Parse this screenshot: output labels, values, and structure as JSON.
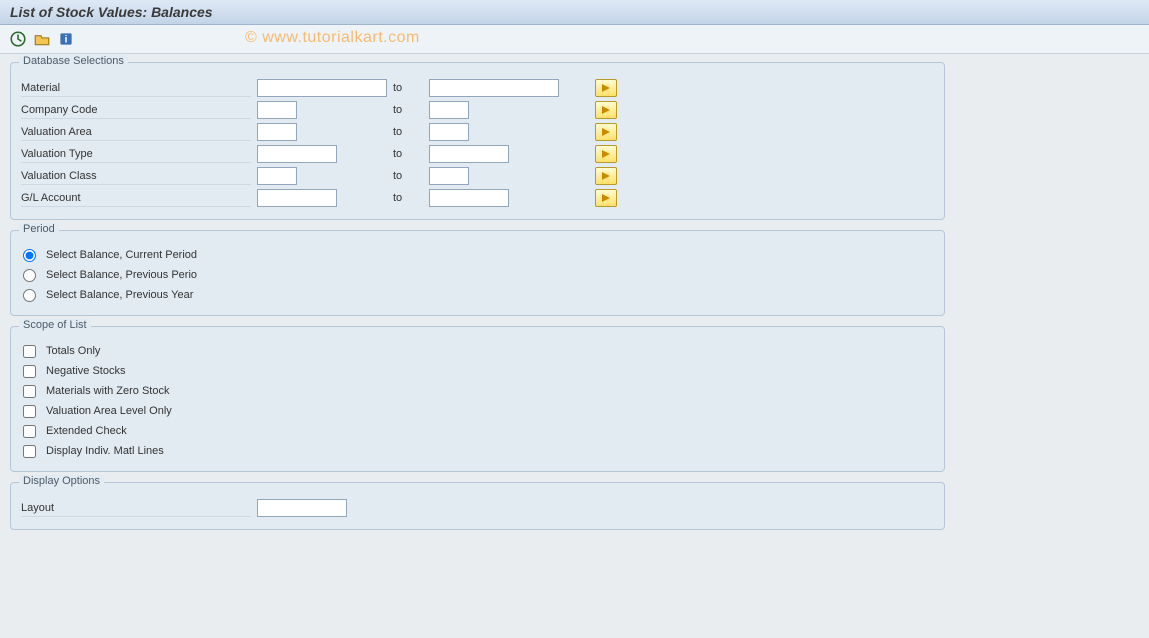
{
  "window": {
    "title": "List of Stock Values: Balances"
  },
  "watermark": "© www.tutorialkart.com",
  "labels": {
    "to": "to"
  },
  "groups": {
    "db": {
      "legend": "Database Selections",
      "fields": {
        "material": {
          "label": "Material",
          "w_from": 130,
          "w_to": 130
        },
        "company": {
          "label": "Company Code",
          "w_from": 40,
          "w_to": 40
        },
        "val_area": {
          "label": "Valuation Area",
          "w_from": 40,
          "w_to": 40
        },
        "val_type": {
          "label": "Valuation Type",
          "w_from": 80,
          "w_to": 80
        },
        "val_class": {
          "label": "Valuation Class",
          "w_from": 40,
          "w_to": 40
        },
        "gl_account": {
          "label": "G/L Account",
          "w_from": 80,
          "w_to": 80
        }
      }
    },
    "period": {
      "legend": "Period",
      "options": {
        "current": {
          "label": "Select Balance, Current Period",
          "checked": true
        },
        "prev_per": {
          "label": "Select Balance, Previous Perio",
          "checked": false
        },
        "prev_year": {
          "label": "Select Balance, Previous Year",
          "checked": false
        }
      }
    },
    "scope": {
      "legend": "Scope of List",
      "options": {
        "totals": {
          "label": "Totals Only"
        },
        "negative": {
          "label": "Negative Stocks"
        },
        "zero": {
          "label": "Materials with Zero Stock"
        },
        "valarea": {
          "label": "Valuation Area Level Only"
        },
        "extcheck": {
          "label": "Extended Check"
        },
        "indiv": {
          "label": "Display Indiv. Matl Lines"
        }
      }
    },
    "display": {
      "legend": "Display Options",
      "layout": {
        "label": "Layout"
      }
    }
  }
}
